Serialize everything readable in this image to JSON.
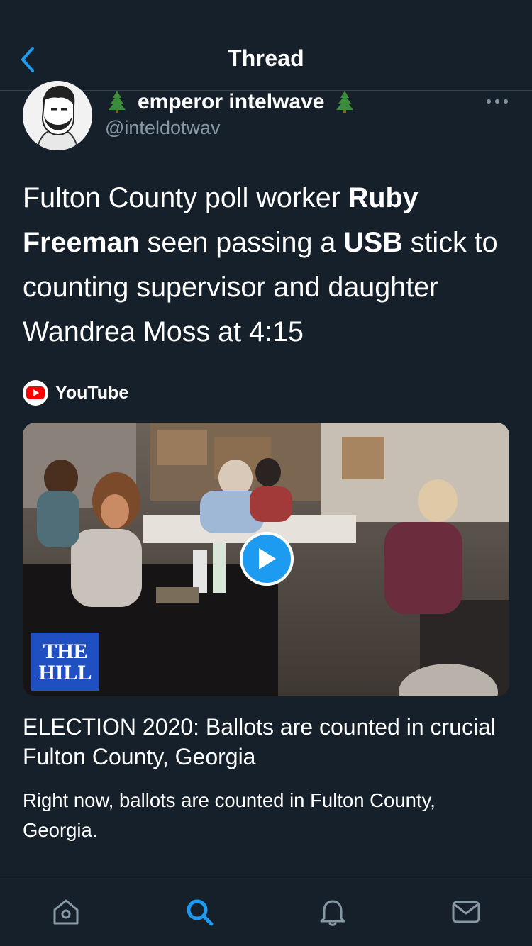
{
  "header": {
    "title": "Thread",
    "back_icon": "chevron-left-icon"
  },
  "author": {
    "display_name": "emperor intelwave",
    "handle": "@inteldotwav",
    "name_decoration": "tree-emoji"
  },
  "tweet": {
    "segments": [
      {
        "text": "Fulton County poll worker ",
        "bold": false
      },
      {
        "text": "Ruby Freeman",
        "bold": true
      },
      {
        "text": " seen passing a ",
        "bold": false
      },
      {
        "text": "USB",
        "bold": true
      },
      {
        "text": " stick to counting supervisor and daughter Wandrea Moss at 4:15",
        "bold": false
      }
    ]
  },
  "link_card": {
    "source": "YouTube",
    "thumbnail_watermark": "THE HILL",
    "title": "ELECTION 2020: Ballots are counted in crucial Fulton County, Georgia",
    "description": "Right now, ballots are counted in Fulton County, Georgia."
  },
  "tabbar": {
    "items": [
      {
        "name": "home",
        "icon": "home-icon",
        "active": false
      },
      {
        "name": "search",
        "icon": "search-icon",
        "active": true
      },
      {
        "name": "notifications",
        "icon": "bell-icon",
        "active": false
      },
      {
        "name": "messages",
        "icon": "mail-icon",
        "active": false
      }
    ]
  },
  "colors": {
    "background": "#15202b",
    "accent": "#1d9bf0",
    "secondary_text": "#8899a6",
    "divider": "#38444d"
  }
}
